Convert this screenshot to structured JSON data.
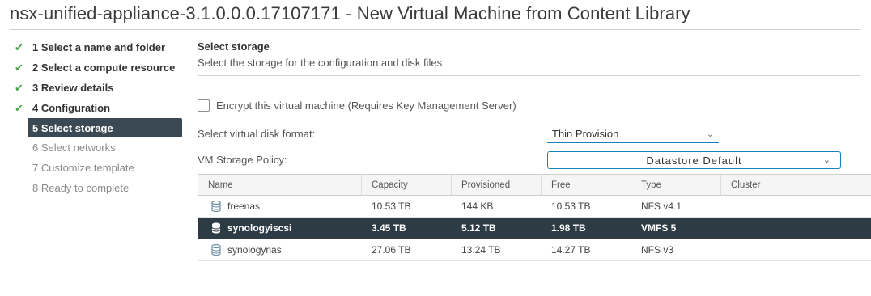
{
  "window": {
    "title": "nsx-unified-appliance-3.1.0.0.0.17107171 - New Virtual Machine from Content Library"
  },
  "wizard": {
    "steps": [
      {
        "label": "1 Select a name and folder",
        "state": "done"
      },
      {
        "label": "2 Select a compute resource",
        "state": "done"
      },
      {
        "label": "3 Review details",
        "state": "done"
      },
      {
        "label": "4 Configuration",
        "state": "done"
      },
      {
        "label": "5 Select storage",
        "state": "active"
      },
      {
        "label": "6 Select networks",
        "state": "pending"
      },
      {
        "label": "7 Customize template",
        "state": "pending"
      },
      {
        "label": "8 Ready to complete",
        "state": "pending"
      }
    ],
    "check_glyph": "✔"
  },
  "storage": {
    "title": "Select storage",
    "subtitle": "Select the storage for the configuration and disk files",
    "encrypt_label": "Encrypt this virtual machine (Requires Key Management Server)",
    "encrypt_checked": false,
    "disk_format_label": "Select virtual disk format:",
    "disk_format_value": "Thin Provision",
    "policy_label": "VM Storage Policy:",
    "policy_value": "Datastore Default",
    "chevron": "⌄"
  },
  "table": {
    "columns": [
      "Name",
      "Capacity",
      "Provisioned",
      "Free",
      "Type",
      "Cluster"
    ],
    "rows": [
      {
        "name": "freenas",
        "capacity": "10.53 TB",
        "provisioned": "144 KB",
        "free": "10.53 TB",
        "type": "NFS v4.1",
        "cluster": "",
        "selected": false
      },
      {
        "name": "synologyiscsi",
        "capacity": "3.45 TB",
        "provisioned": "5.12 TB",
        "free": "1.98 TB",
        "type": "VMFS 5",
        "cluster": "",
        "selected": true
      },
      {
        "name": "synologynas",
        "capacity": "27.06 TB",
        "provisioned": "13.24 TB",
        "free": "14.27 TB",
        "type": "NFS v3",
        "cluster": "",
        "selected": false
      }
    ],
    "row_icon": "datastore-icon"
  },
  "colors": {
    "accent": "#1a7fbf",
    "check": "#4aa34a",
    "selected_bg": "#2d3b44",
    "active_step_bg": "#3a4954"
  }
}
